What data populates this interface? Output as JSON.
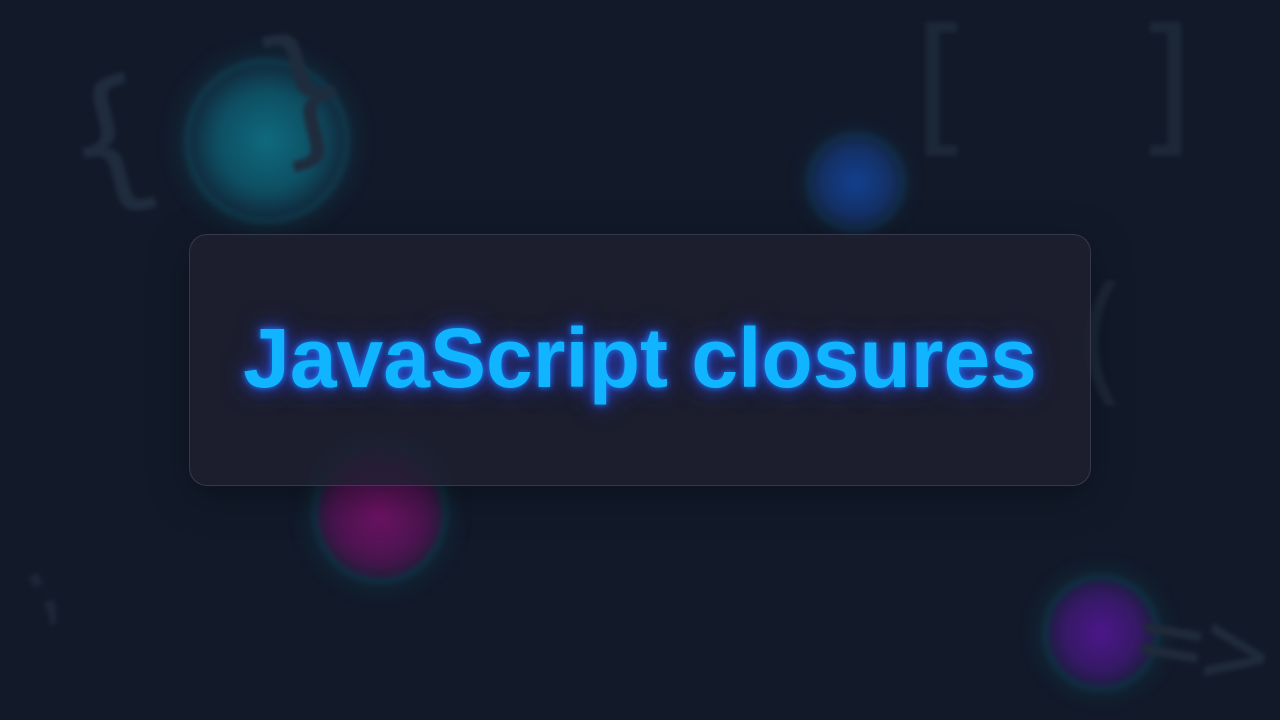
{
  "title": "JavaScript closures",
  "background_symbols": {
    "braces": "{ }",
    "brackets": "[ ]",
    "paren": "(",
    "semicolon": ";",
    "arrow": "=>"
  },
  "colors": {
    "background": "#121a2a",
    "title": "#10b4ff",
    "title_glow": "#285aff",
    "card": "#1e2030"
  }
}
